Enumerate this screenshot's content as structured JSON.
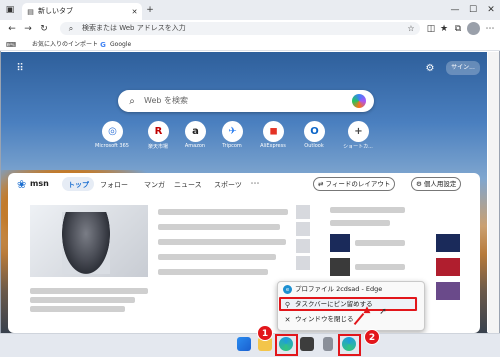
{
  "browser": {
    "tab_title": "新しいタブ",
    "address_placeholder": "検索または Web アドレスを入力",
    "favorites": [
      "お気に入りのインポート",
      "Google"
    ]
  },
  "msn": {
    "search_placeholder": "Web を検索",
    "signin_label": "サイン...",
    "tiles": [
      {
        "label": "Microsoft 365",
        "icon": "microsoft-365-icon",
        "glyph": "◎",
        "color": "#2b6fd6"
      },
      {
        "label": "楽天市場",
        "icon": "rakuten-icon",
        "glyph": "R",
        "color": "#bf0000"
      },
      {
        "label": "Amazon",
        "icon": "amazon-icon",
        "glyph": "a",
        "color": "#222222"
      },
      {
        "label": "Tripcom",
        "icon": "tripcom-icon",
        "glyph": "✈",
        "color": "#2d7ff0"
      },
      {
        "label": "AliExpress",
        "icon": "aliexpress-icon",
        "glyph": "◼",
        "color": "#e43225"
      },
      {
        "label": "Outlook",
        "icon": "outlook-icon",
        "glyph": "O",
        "color": "#0a64c7"
      },
      {
        "label": "ショートカ...",
        "icon": "add-icon",
        "glyph": "+",
        "color": "#444444"
      }
    ],
    "logo": "msn",
    "nav": [
      "トップ",
      "フォロー",
      "マンガ",
      "ニュース",
      "スポーツ"
    ],
    "feed_layout_label": "フィードのレイアウト",
    "personal_settings_label": "個人用設定"
  },
  "jump_list": {
    "header": "プロファイル 2cdsad - Edge",
    "pin": "タスクバーにピン留めする",
    "close": "ウィンドウを閉じる"
  },
  "badges": [
    "1",
    "2"
  ],
  "colors": {
    "highlight": "#e2161b",
    "msn_blue": "#1c6fd1"
  }
}
